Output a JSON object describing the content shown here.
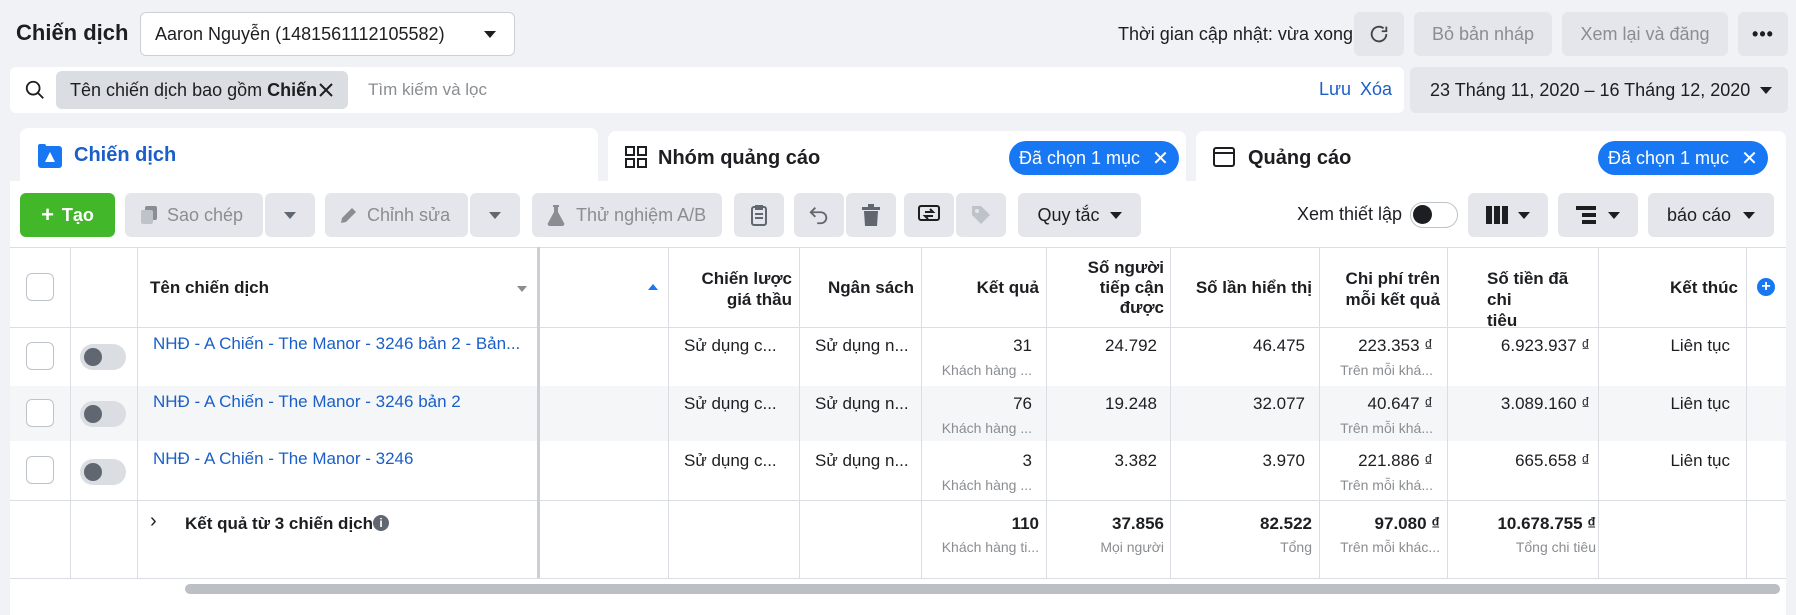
{
  "header": {
    "title": "Chiến dịch",
    "account_select": "Aaron Nguyễn (1481561112105582)",
    "updated_text": "Thời gian cập nhật: vừa xong",
    "discard_draft": "Bỏ bản nháp",
    "review_publish": "Xem lại và đăng"
  },
  "filter": {
    "chip_prefix": "Tên chiến dịch bao gồm ",
    "chip_value": "Chiến",
    "placeholder": "Tìm kiếm và lọc",
    "save": "Lưu",
    "clear": "Xóa",
    "date_range": "23 Tháng 11, 2020 – 16 Tháng 12, 2020"
  },
  "tabs": [
    {
      "label": "Chiến dịch"
    },
    {
      "label": "Nhóm quảng cáo",
      "badge": "Đã chọn 1 mục"
    },
    {
      "label": "Quảng cáo",
      "badge": "Đã chọn 1 mục"
    }
  ],
  "toolbar": {
    "create": "Tạo",
    "copy": "Sao chép",
    "edit": "Chỉnh sửa",
    "ab_test": "Thử nghiệm A/B",
    "rules": "Quy tắc",
    "view_setup": "Xem thiết lập",
    "reports": "báo cáo"
  },
  "table": {
    "headers": {
      "name": "Tên chiến dịch",
      "bid_1": "Chiến lược",
      "bid_2": "giá thầu",
      "budget": "Ngân sách",
      "results": "Kết quả",
      "reach_1": "Số người",
      "reach_2": "tiếp cận",
      "reach_3": "được",
      "impressions": "Số lần hiển thị",
      "cpr_1": "Chi phí trên",
      "cpr_2": "mỗi kết quả",
      "spent_1": "Số tiền đã chi",
      "spent_2": "tiêu",
      "end": "Kết thúc"
    },
    "rows": [
      {
        "name": "NHĐ - A Chiến - The Manor - 3246 bản 2 - Bản...",
        "bid": "Sử dụng c...",
        "budget": "Sử dụng n...",
        "results": "31",
        "results_sub": "Khách hàng ...",
        "reach": "24.792",
        "impressions": "46.475",
        "cpr": "223.353 ₫",
        "cpr_sub": "Trên mỗi khá...",
        "spent": "6.923.937 ₫",
        "end": "Liên tục"
      },
      {
        "name": "NHĐ - A Chiến - The Manor - 3246 bản 2",
        "bid": "Sử dụng c...",
        "budget": "Sử dụng n...",
        "results": "76",
        "results_sub": "Khách hàng ...",
        "reach": "19.248",
        "impressions": "32.077",
        "cpr": "40.647 ₫",
        "cpr_sub": "Trên mỗi khá...",
        "spent": "3.089.160 ₫",
        "end": "Liên tục"
      },
      {
        "name": "NHĐ - A Chiến - The Manor - 3246",
        "bid": "Sử dụng c...",
        "budget": "Sử dụng n...",
        "results": "3",
        "results_sub": "Khách hàng ...",
        "reach": "3.382",
        "impressions": "3.970",
        "cpr": "221.886 ₫",
        "cpr_sub": "Trên mỗi khá...",
        "spent": "665.658 ₫",
        "end": "Liên tục"
      }
    ],
    "summary": {
      "label": "Kết quả từ 3 chiến dịch",
      "results": "110",
      "results_sub": "Khách hàng ti...",
      "reach": "37.856",
      "reach_sub": "Mọi người",
      "impressions": "82.522",
      "impressions_sub": "Tổng",
      "cpr": "97.080 ₫",
      "cpr_sub": "Trên mỗi khác...",
      "spent": "10.678.755 ₫",
      "spent_sub": "Tổng chi tiêu"
    }
  },
  "colors": {
    "accent": "#1877f2",
    "create": "#42b72a",
    "link": "#1a5fc8"
  }
}
